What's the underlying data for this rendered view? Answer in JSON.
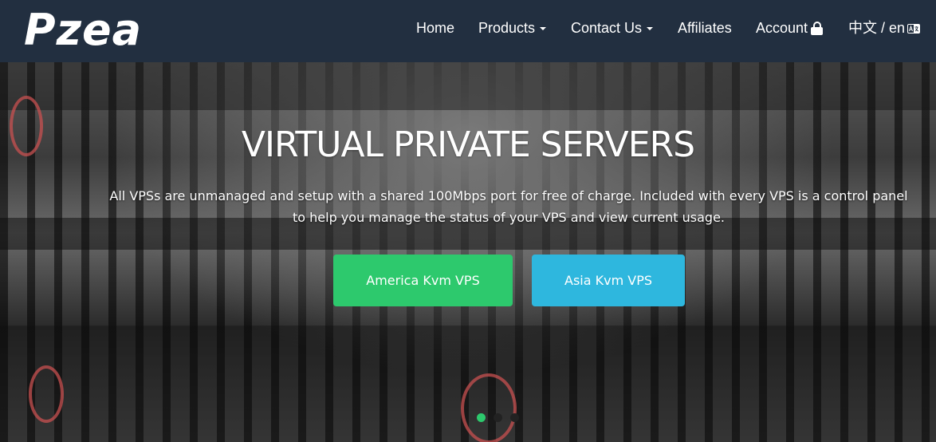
{
  "brand": {
    "logo_text": "Pzea"
  },
  "nav": {
    "home": "Home",
    "products": "Products",
    "contact": "Contact Us",
    "affiliates": "Affiliates",
    "account": "Account",
    "language": "中文 / en"
  },
  "hero": {
    "title": "VIRTUAL PRIVATE SERVERS",
    "description_line1": "All VPSs are unmanaged and setup with a shared 100Mbps port for free of charge. Included with every VPS is a control panel",
    "description_line2": "to help you manage the status of your VPS and view current usage.",
    "buttons": [
      {
        "label": "America Kvm VPS",
        "color": "#2dc96d"
      },
      {
        "label": "Asia Kvm VPS",
        "color": "#2eb7de"
      }
    ],
    "slides": {
      "count": 3,
      "active": 1
    }
  },
  "colors": {
    "navbar": "#222f40",
    "active_dot": "#2dc96d"
  },
  "icons": {
    "account": "lock-icon",
    "language": "language-icon",
    "dropdown": "caret-down-icon"
  }
}
